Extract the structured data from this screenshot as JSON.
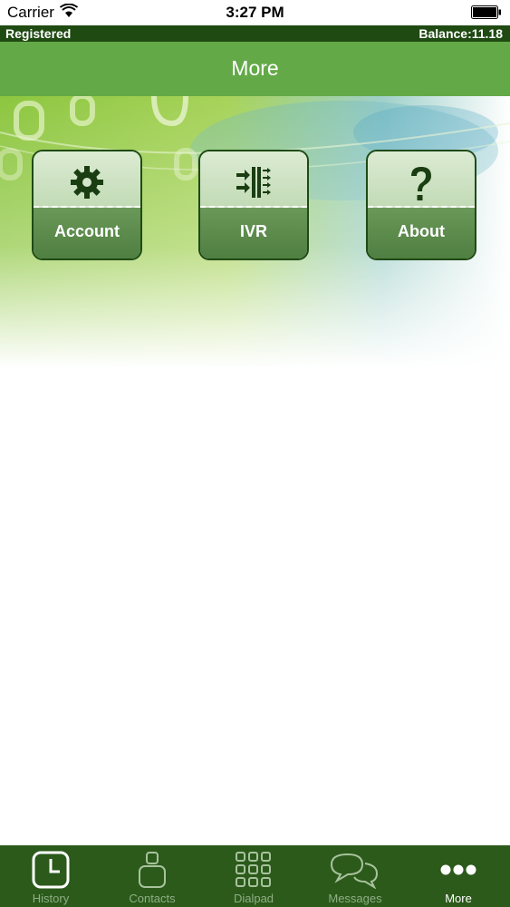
{
  "status_bar": {
    "carrier": "Carrier",
    "time": "3:27 PM"
  },
  "registration": {
    "status": "Registered",
    "balance": "Balance:11.18"
  },
  "header": {
    "title": "More"
  },
  "tiles": [
    {
      "label": "Account",
      "icon": "gear-icon"
    },
    {
      "label": "IVR",
      "icon": "ivr-icon"
    },
    {
      "label": "About",
      "icon": "question-mark-icon"
    }
  ],
  "tab_bar": {
    "active": "More",
    "items": [
      {
        "label": "History",
        "icon": "clock-icon"
      },
      {
        "label": "Contacts",
        "icon": "person-icon"
      },
      {
        "label": "Dialpad",
        "icon": "dialpad-icon"
      },
      {
        "label": "Messages",
        "icon": "speech-bubbles-icon"
      },
      {
        "label": "More",
        "icon": "more-dots-icon"
      }
    ]
  },
  "colors": {
    "header": "#64a948",
    "registration_bar": "#1f4a12",
    "tab_bar": "#2b5a1b",
    "tile_border": "#1e4a14",
    "tile_lower": "#5a8a4a"
  }
}
